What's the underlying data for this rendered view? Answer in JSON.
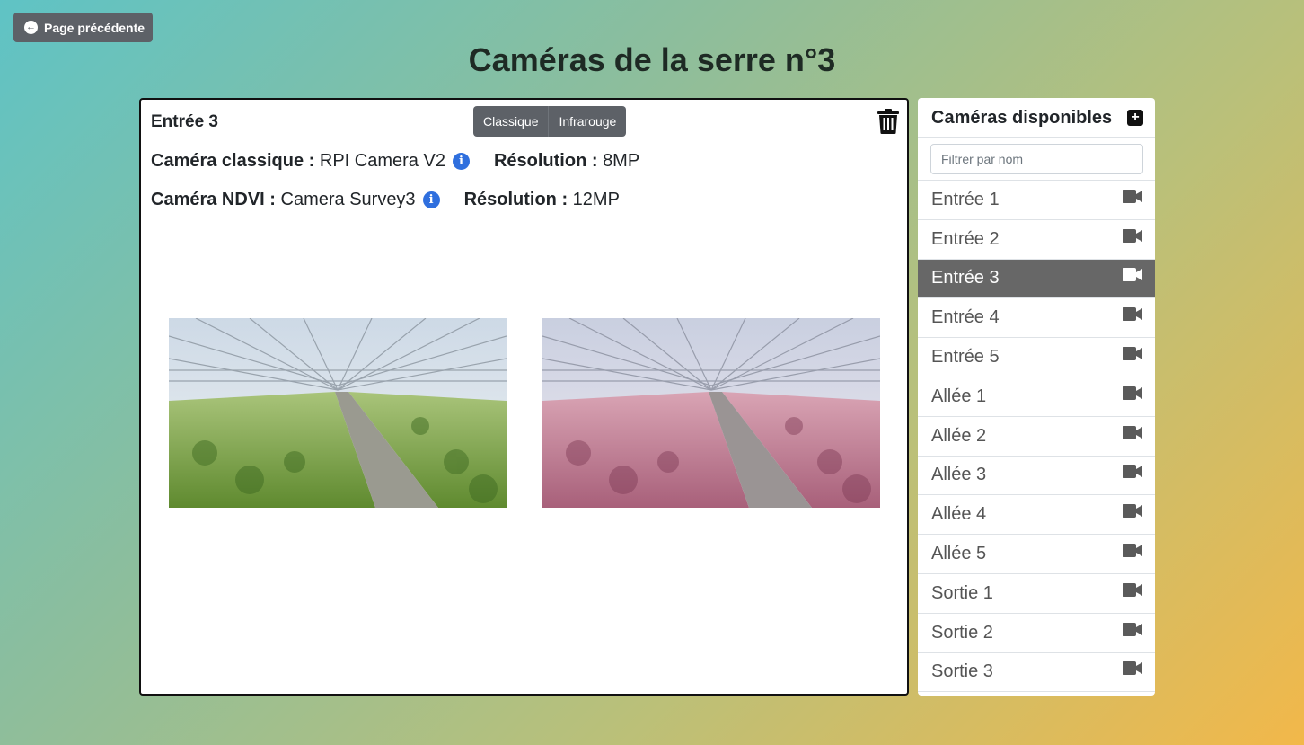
{
  "nav": {
    "back_label": "Page précédente"
  },
  "page": {
    "title": "Caméras de la serre n°3"
  },
  "camera": {
    "name": "Entrée 3",
    "view_modes": [
      "Classique",
      "Infrarouge"
    ],
    "classic": {
      "label": "Caméra classique :",
      "model": "RPI Camera V2",
      "resolution_label": "Résolution :",
      "resolution": "8MP"
    },
    "ndvi": {
      "label": "Caméra NDVI :",
      "model": "Camera Survey3",
      "resolution_label": "Résolution :",
      "resolution": "12MP"
    }
  },
  "sidebar": {
    "title": "Caméras disponibles",
    "filter_placeholder": "Filtrer par nom",
    "selected": "Entrée 3",
    "items": [
      {
        "label": "Entrée 1"
      },
      {
        "label": "Entrée 2"
      },
      {
        "label": "Entrée 3"
      },
      {
        "label": "Entrée 4"
      },
      {
        "label": "Entrée 5"
      },
      {
        "label": "Allée 1"
      },
      {
        "label": "Allée 2"
      },
      {
        "label": "Allée 3"
      },
      {
        "label": "Allée 4"
      },
      {
        "label": "Allée 5"
      },
      {
        "label": "Sortie 1"
      },
      {
        "label": "Sortie 2"
      },
      {
        "label": "Sortie 3"
      }
    ]
  },
  "icons": {
    "back": "arrow-left-circle-icon",
    "delete": "trash-icon",
    "info": "info-circle-icon",
    "add": "plus-square-icon",
    "camera": "video-camera-icon"
  },
  "colors": {
    "button_gray": "#5d6167",
    "active_item": "#676767",
    "info_blue": "#2f6fde",
    "classic_foliage": "#7fa54a",
    "infrared_foliage": "#c98a9c"
  }
}
